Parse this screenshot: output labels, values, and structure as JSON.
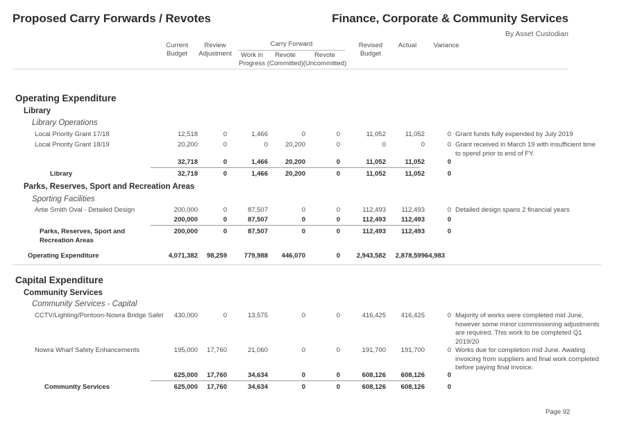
{
  "header": {
    "title_left": "Proposed Carry Forwards / Revotes",
    "title_right": "Finance, Corporate & Community Services",
    "subtitle_right": "By Asset Custodian"
  },
  "columns": {
    "current_budget_l1": "Current",
    "current_budget_l2": "Budget",
    "review_adjustment_l1": "Review",
    "review_adjustment_l2": "Adjustment",
    "carry_forward_group": "Carry Forward",
    "work_in_progress_l1": "Work in",
    "work_in_progress_l2": "Progress",
    "revote_committed_l1": "Revote",
    "revote_committed_l2": "(Committed)",
    "revote_uncommitted_l1": "Revote",
    "revote_uncommitted_l2": "(Uncommitted)",
    "revised_budget_l1": "Revised",
    "revised_budget_l2": "Budget",
    "actual": "Actual",
    "variance": "Variance"
  },
  "sections": {
    "operating": {
      "heading": "Operating Expenditure",
      "groups": [
        {
          "heading": "Library",
          "subheading": "Library Operations",
          "rows": [
            {
              "label": "Local Priority Grant 17/18",
              "current_budget": "12,518",
              "review_adjustment": "0",
              "work_in_progress": "1,466",
              "revote_committed": "0",
              "revote_uncommitted": "0",
              "revised_budget": "11,052",
              "actual": "11,052",
              "variance": "0",
              "comment": "Grant funds fully expended by July 2019"
            },
            {
              "label": "Local Priority Grant 18/19",
              "current_budget": "20,200",
              "review_adjustment": "0",
              "work_in_progress": "0",
              "revote_committed": "20,200",
              "revote_uncommitted": "0",
              "revised_budget": "0",
              "actual": "0",
              "variance": "0",
              "comment": "Grant received in March 19 with insufficient time to spend prior to end of FY."
            }
          ],
          "subtotal": {
            "label": "",
            "current_budget": "32,718",
            "review_adjustment": "0",
            "work_in_progress": "1,466",
            "revote_committed": "20,200",
            "revote_uncommitted": "0",
            "revised_budget": "11,052",
            "actual": "11,052",
            "variance": "0"
          },
          "total": {
            "label": "Library",
            "current_budget": "32,718",
            "review_adjustment": "0",
            "work_in_progress": "1,466",
            "revote_committed": "20,200",
            "revote_uncommitted": "0",
            "revised_budget": "11,052",
            "actual": "11,052",
            "variance": "0"
          }
        },
        {
          "heading": "Parks, Reserves, Sport and Recreation Areas",
          "subheading": "Sporting Facilities",
          "rows": [
            {
              "label": "Artie Smith Oval -  Detailed Design",
              "current_budget": "200,000",
              "review_adjustment": "0",
              "work_in_progress": "87,507",
              "revote_committed": "0",
              "revote_uncommitted": "0",
              "revised_budget": "112,493",
              "actual": "112,493",
              "variance": "0",
              "comment": "Detailed design spans 2 financial years"
            }
          ],
          "subtotal": {
            "label": "",
            "current_budget": "200,000",
            "review_adjustment": "0",
            "work_in_progress": "87,507",
            "revote_committed": "0",
            "revote_uncommitted": "0",
            "revised_budget": "112,493",
            "actual": "112,493",
            "variance": "0"
          },
          "total": {
            "label_line1": "Parks, Reserves, Sport and",
            "label_line2": "Recreation Areas",
            "current_budget": "200,000",
            "review_adjustment": "0",
            "work_in_progress": "87,507",
            "revote_committed": "0",
            "revote_uncommitted": "0",
            "revised_budget": "112,493",
            "actual": "112,493",
            "variance": "0"
          }
        }
      ],
      "grand_total": {
        "label": "Operating Expenditure",
        "current_budget": "4,071,382",
        "review_adjustment": "98,259",
        "work_in_progress": "779,988",
        "revote_committed": "446,070",
        "revote_uncommitted": "0",
        "revised_budget": "2,943,582",
        "actual": "2,878,599",
        "variance": "64,983"
      }
    },
    "capital": {
      "heading": "Capital Expenditure",
      "groups": [
        {
          "heading": "Community Services",
          "subheading": "Community Services - Capital",
          "rows": [
            {
              "label": "CCTV/Lighting/Pontoon-Nowra Bridge Safet",
              "current_budget": "430,000",
              "review_adjustment": "0",
              "work_in_progress": "13,575",
              "revote_committed": "0",
              "revote_uncommitted": "0",
              "revised_budget": "416,425",
              "actual": "416,425",
              "variance": "0",
              "comment": "Majority of works were completed mid June, however some minor commissioning adjustments are required.  This work to be completed Q1 2019/20"
            },
            {
              "label": "Nowra Wharf Safety Enhancements",
              "current_budget": "195,000",
              "review_adjustment": "17,760",
              "work_in_progress": "21,060",
              "revote_committed": "0",
              "revote_uncommitted": "0",
              "revised_budget": "191,700",
              "actual": "191,700",
              "variance": "0",
              "comment": "Works due for completion mid June. Awating invoicing from suppliers and final work completed before paying final invoice."
            }
          ],
          "subtotal": {
            "label": "",
            "current_budget": "625,000",
            "review_adjustment": "17,760",
            "work_in_progress": "34,634",
            "revote_committed": "0",
            "revote_uncommitted": "0",
            "revised_budget": "608,126",
            "actual": "608,126",
            "variance": "0"
          },
          "total": {
            "label": "Community Services",
            "current_budget": "625,000",
            "review_adjustment": "17,760",
            "work_in_progress": "34,634",
            "revote_committed": "0",
            "revote_uncommitted": "0",
            "revised_budget": "608,126",
            "actual": "608,126",
            "variance": "0"
          }
        }
      ]
    }
  },
  "footer": {
    "page_label": "Page 92"
  }
}
